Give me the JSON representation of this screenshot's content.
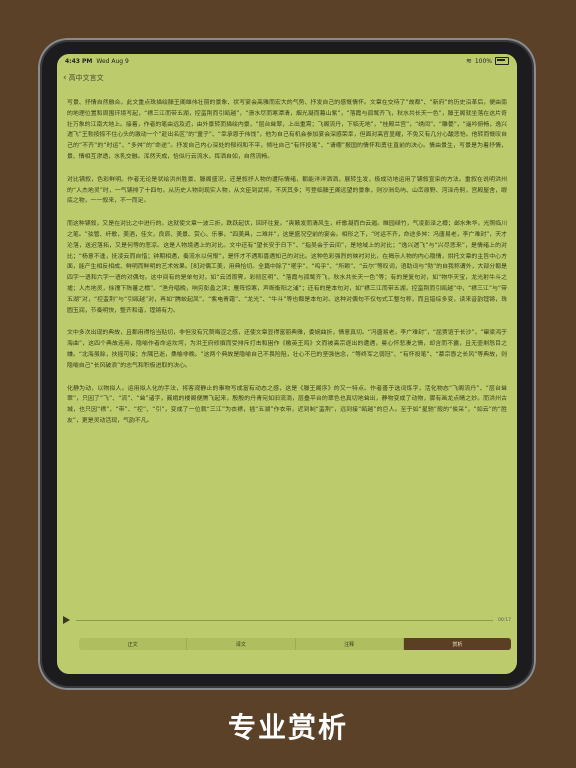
{
  "status": {
    "time": "4:43 PM",
    "date": "Wed Aug 9",
    "battery": "100%"
  },
  "nav": {
    "back_label": "高中文言文"
  },
  "article": {
    "paragraphs": [
      "写景、抒情自然融合。此文重点珠描绘滕王阁雄伟壮丽的景象、状写宴会高雅而宏大的气势、抒发自己的感慨情怀。文章在交待了“故都”、“新府”的历史沿革后，便由南的地理位置和周围环境写起，“襟三江而带五湖，控蛮荆而引瓯越”，“潦水尽而寒潭清，烟光凝而暮山紫”，“落霞与孤鹜齐飞，秋水共长天一色”，滕王阁就坐落在这片奇壮万象的江南大地上。接着，作者的笔由远及近，由外景转而描绘内景，“层台耸翠，上出重霄；飞阁流丹，下临无地”，“桂殿兰宫”，“绣闼”、“雕甍”，“遥吟俯畅，逸兴遄飞”王勃按捺不住心头的激动一个“趁出名区”的“童子”、“幸承恩于伟饯”，他为自己有机会参加宴会深感荣幸，但面对高官显耀，不免又有几分心酸悲怆。他转而慨叹自己的“不齐”的“时运”、“多舛”的“命途”。抒发自己内心深处的郁闷和不平，倾吐自己“有怀投笔”、“请缨”报国的情怀和勇往直前的决心。情由景生，写景是为着抒情，景、情相互渗透，水乳交融。浑然天成，恰似行云流水，挥洒自如，自然流畅。",
      "对比铺叙，色彩鲜明。作者无论是状绘洪州胜景、滕阁盛况，还是叙抒人物的遭际情绪，都能洋洋洒洒，展转生发，极成功地运用了铺叙宣染的方法。重叙在说明洪州的“人杰地灵”时，一气铺排了十四句，从历史人物到现实人物，从文臣到武将，不厌其多；写登临滕王阁远望的景象，则沙洲岛屿、山峦原野、河泽舟舸，宫殿屋舍，眼底之物，一一叙来，不一而足。",
      "而这种铺叙，又是在对比之中进行的。这就使文章一波三折，跌跃起伏，回环往复。“爽籁发而清风生，纤歌凝而白云遏。睢园绿竹，气凌彭泽之樽；邺水朱华，光照临川之笔。”弦管、纤歌，美酒，佳文，良辰、美景、赏心、乐事，“四美具，二难并”，这是盛况空前的宴会。相形之下，“时运不齐，命途多舛：冯唐易老，李广难封”，天才沦落，送迟落拓，又是何等的悲凉。这是人物境遇上的对比。文中还有“望长安于日下”、“指吴会于云间”，是地域上的对比；“逸兴遄飞”与“兴尽悲来”，是情绪上的对比；“杨意不逢，抚凌云而自惜；钟期相遇，奏流水以何惭”，是怀才不遇和喜遇知己的对比。这种色彩强烈的映衬对比，在揭示人物的内心隐情，烘托文章的主旨中心方面，能产生相反相成、鲜明而鲜明的艺术效果。[8]对偶工美，用典恰切。全篇中除了“嗟乎”、“呜乎”、“所赖”、“云尔”等叹词，语助词与“勃”的自我称谓外，大部分都是四字一语和六字一语的对偶句。这中间有的是单句对，如“云消雨霁，彩彻区明”、“落霞与孤鹜齐飞，秋水共长天一色”等；有的是复句对，如“物华天宝，龙光射牛斗之墟；人杰地灵，徐孺下陈蕃之榻”、“渔舟唱晚，响穷彭蠡之滨；雁阵惊寒，声断衡阳之浦”；还有的是本句对，如“襟三江而带五湖，控蛮荆而引瓯越”中，“襟三江”与“带五湖”对，“控蛮荆”与“引瓯越”对，再如“腾蛟起凤”、“紫电青霜”、“龙光”、“牛斗”等也都是本句对。这种对偶句不仅句式工整匀称，而且错综多变，读来音韵铿锵，珠圆玉润，节奏明快，整齐和谐，铿锵有力。",
      "文中多次出现的典故，且都用得恰当贴切，非但没有冗赘晦涩之感，还使文章显得富丽典雅，委婉曲折，情意真切。“冯唐易老，李广难封”，“屈贾谊于长沙”，“窜梁鸿于海曲”，这四个典故连用，隐喻作者命运坎坷，为洪王府修撰而受排斥打击和困作《檄英王鸡》文而被高宗逐出的遭遇，曼心怀悲凄之情，却含而不露，且无壶剩怒目之嫌。“北海虽赊，扶摇可接；东隅已逝，桑榆非晚。”这两个典故是隐喻自己不畏险阻，壮心不已的坚强信念，“等终军之弱冠”、“有怀投笔”、“慕宗悫之长风”等典故，则隐喻自己“长风破浪”的志气和积极进取的决心。",
      "化静为动，以物拟人。运用拟人化的手法，将客观静止的事物写成富有动态之感，这是《滕王阁序》的又一特点。作者善于选词炼字，活化物态“飞阁流丹”、“层台耸翠”，只因了“飞”、“流”、“耸”诸字，巍峨的楼阁便腾飞起来，殷殷的丹青宛如旧流淌，层叠平台的翠色也真切地耸出，静物变成了动物，骤有画龙点睛之妙。而洪州古城，也只因“襟”、“带”、“控”、“引”，变成了一位裁“三江”为衣襟，插“五湖”作衣带，近到制“蛮荆”，远到接“瓯越”的巨人。至于如“星驰”般的“俊采”，“如云”的“胜友”，更是灵动活现，气韵不凡。"
    ]
  },
  "player": {
    "time": "00:17"
  },
  "tabs": [
    {
      "label": "正文"
    },
    {
      "label": "译文"
    },
    {
      "label": "注释"
    },
    {
      "label": "赏析"
    }
  ],
  "caption": "专业赏析"
}
